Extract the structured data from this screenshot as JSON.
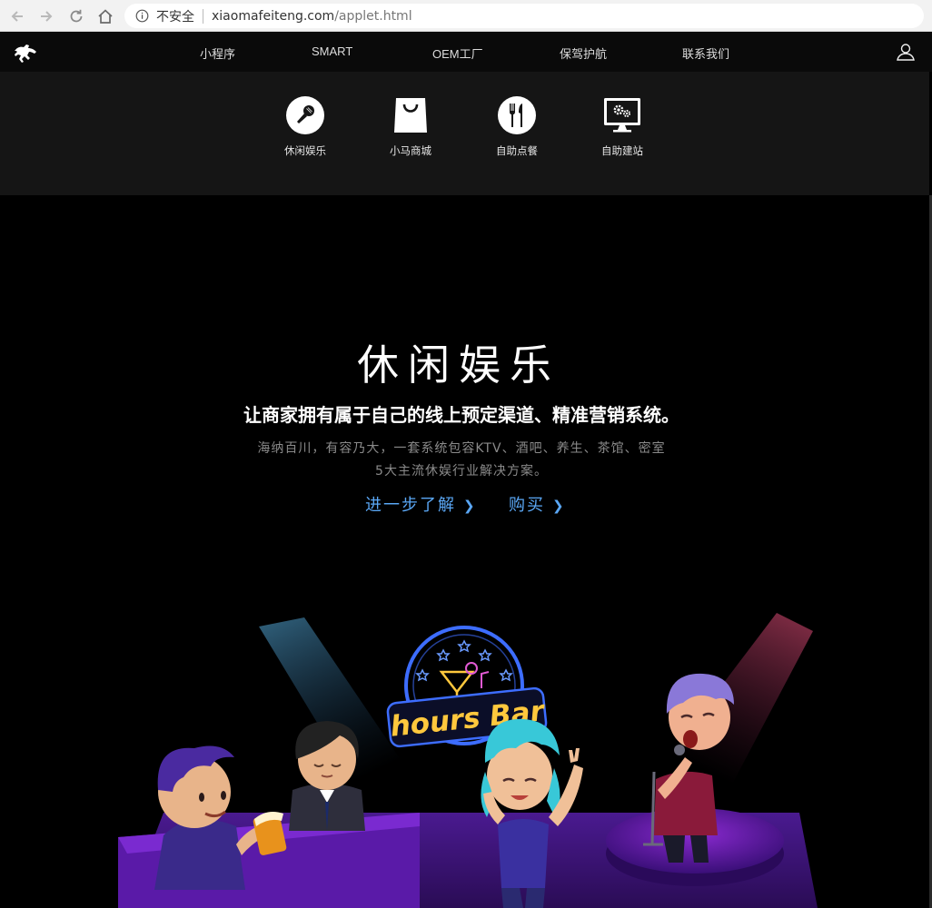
{
  "browser": {
    "security_label": "不安全",
    "url_host": "xiaomafeiteng.com",
    "url_path": "/applet.html"
  },
  "header": {
    "nav": [
      "小程序",
      "SMART",
      "OEM工厂",
      "保驾护航",
      "联系我们"
    ]
  },
  "sub_nav": [
    {
      "label": "休闲娱乐",
      "icon": "microphone-icon"
    },
    {
      "label": "小马商城",
      "icon": "shopping-bag-icon"
    },
    {
      "label": "自助点餐",
      "icon": "fork-knife-icon"
    },
    {
      "label": "自助建站",
      "icon": "monitor-gear-icon"
    }
  ],
  "hero": {
    "title": "休闲娱乐",
    "subtitle": "让商家拥有属于自己的线上预定渠道、精准营销系统。",
    "desc_line1": "海纳百川，有容乃大，一套系统包容KTV、酒吧、养生、茶馆、密室",
    "desc_line2": "5大主流休娱行业解决方案。",
    "learn_more": "进一步了解",
    "buy": "购买"
  },
  "illustration": {
    "sign_text": "hours Bar"
  },
  "colors": {
    "accent_link": "#5aa7f5",
    "neon_yellow": "#ffc83d",
    "neon_blue": "#3d6dff",
    "stage_purple": "#5a1aa8"
  }
}
